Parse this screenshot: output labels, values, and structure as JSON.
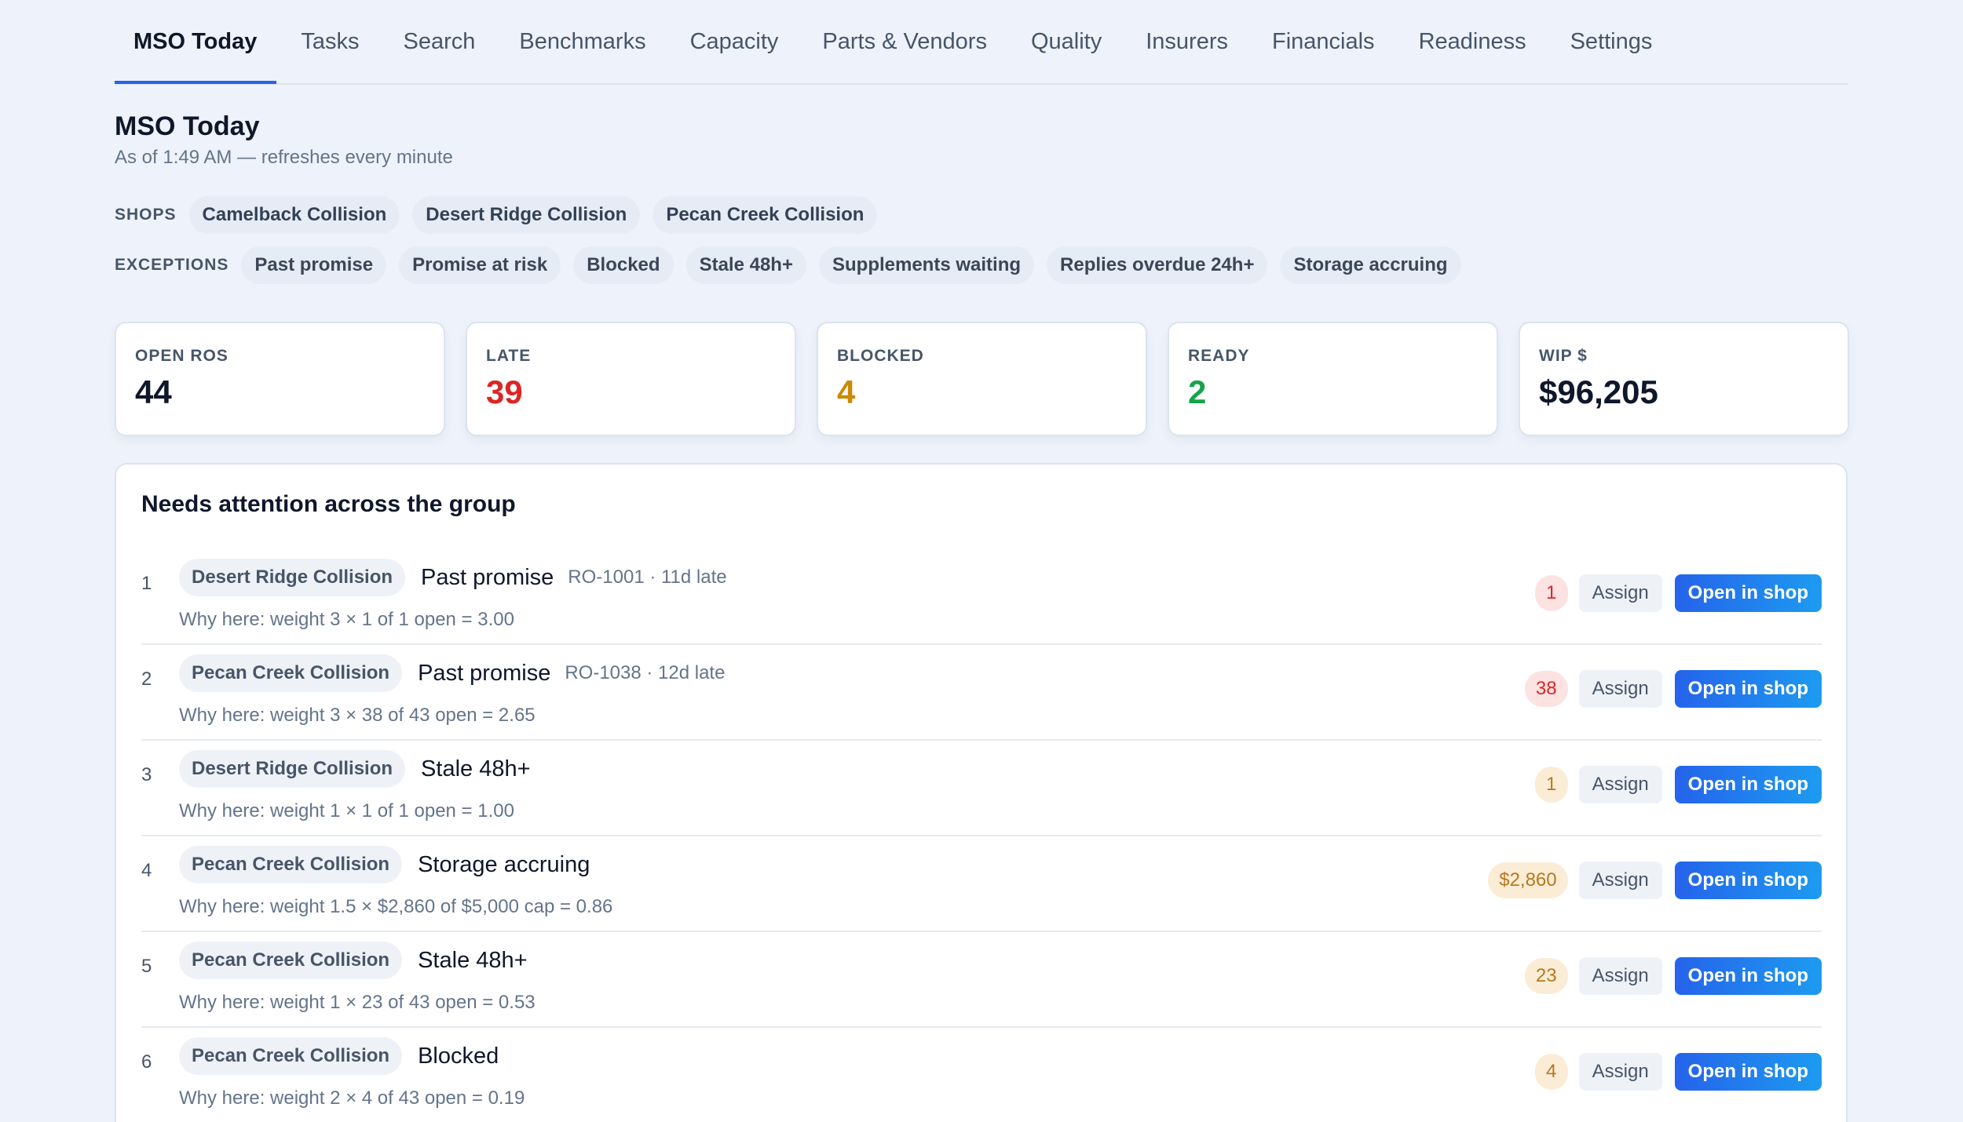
{
  "tabs": [
    {
      "label": "MSO Today",
      "active": true
    },
    {
      "label": "Tasks"
    },
    {
      "label": "Search"
    },
    {
      "label": "Benchmarks"
    },
    {
      "label": "Capacity"
    },
    {
      "label": "Parts & Vendors"
    },
    {
      "label": "Quality"
    },
    {
      "label": "Insurers"
    },
    {
      "label": "Financials"
    },
    {
      "label": "Readiness"
    },
    {
      "label": "Settings"
    }
  ],
  "header": {
    "title": "MSO Today",
    "subtitle": "As of 1:49 AM — refreshes every minute"
  },
  "filters": {
    "shops_label": "SHOPS",
    "shops": [
      "Camelback Collision",
      "Desert Ridge Collision",
      "Pecan Creek Collision"
    ],
    "exceptions_label": "EXCEPTIONS",
    "exceptions": [
      "Past promise",
      "Promise at risk",
      "Blocked",
      "Stale 48h+",
      "Supplements waiting",
      "Replies overdue 24h+",
      "Storage accruing"
    ]
  },
  "stats": [
    {
      "label": "OPEN ROS",
      "value": "44",
      "color": "#0f172a"
    },
    {
      "label": "LATE",
      "value": "39",
      "color": "#dc2626"
    },
    {
      "label": "BLOCKED",
      "value": "4",
      "color": "#ca8a04"
    },
    {
      "label": "READY",
      "value": "2",
      "color": "#16a34a"
    },
    {
      "label": "WIP $",
      "value": "$96,205",
      "color": "#0f172a"
    }
  ],
  "attention": {
    "title": "Needs attention across the group",
    "assign_label": "Assign",
    "open_label": "Open in shop",
    "items": [
      {
        "num": "1",
        "shop": "Desert Ridge Collision",
        "issue": "Past promise",
        "meta": "RO-1001 · 11d late",
        "why": "Why here: weight 3 × 1 of 1 open = 3.00",
        "badge": "1",
        "badge_tone": "red"
      },
      {
        "num": "2",
        "shop": "Pecan Creek Collision",
        "issue": "Past promise",
        "meta": "RO-1038 · 12d late",
        "why": "Why here: weight 3 × 38 of 43 open = 2.65",
        "badge": "38",
        "badge_tone": "red"
      },
      {
        "num": "3",
        "shop": "Desert Ridge Collision",
        "issue": "Stale 48h+",
        "meta": "",
        "why": "Why here: weight 1 × 1 of 1 open = 1.00",
        "badge": "1",
        "badge_tone": "amber"
      },
      {
        "num": "4",
        "shop": "Pecan Creek Collision",
        "issue": "Storage accruing",
        "meta": "",
        "why": "Why here: weight 1.5 × $2,860 of $5,000 cap = 0.86",
        "badge": "$2,860",
        "badge_tone": "amber"
      },
      {
        "num": "5",
        "shop": "Pecan Creek Collision",
        "issue": "Stale 48h+",
        "meta": "",
        "why": "Why here: weight 1 × 23 of 43 open = 0.53",
        "badge": "23",
        "badge_tone": "amber"
      },
      {
        "num": "6",
        "shop": "Pecan Creek Collision",
        "issue": "Blocked",
        "meta": "",
        "why": "Why here: weight 2 × 4 of 43 open = 0.19",
        "badge": "4",
        "badge_tone": "amber"
      }
    ]
  }
}
